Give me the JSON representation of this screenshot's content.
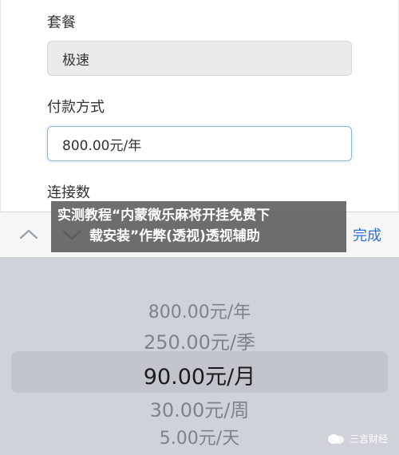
{
  "form": {
    "plan_label": "套餐",
    "plan_value": "极速",
    "payment_label": "付款方式",
    "payment_value": "800.00元/年",
    "connections_label": "连接数"
  },
  "toolbar": {
    "done_label": "完成"
  },
  "overlay": {
    "line1": "实测教程“内蒙微乐麻将开挂免费下",
    "line2": "载安装”作弊(透视)透视辅助"
  },
  "picker": {
    "options": [
      "800.00元/年",
      "250.00元/季",
      "90.00元/月",
      "30.00元/周",
      "5.00元/天"
    ],
    "selected": "90.00元/月"
  },
  "watermark": {
    "text": "三言财经"
  },
  "colors": {
    "accent": "#2f6fd6",
    "picker_bg": "#cfd2d8",
    "input_focus_border": "#8ab4ea"
  }
}
